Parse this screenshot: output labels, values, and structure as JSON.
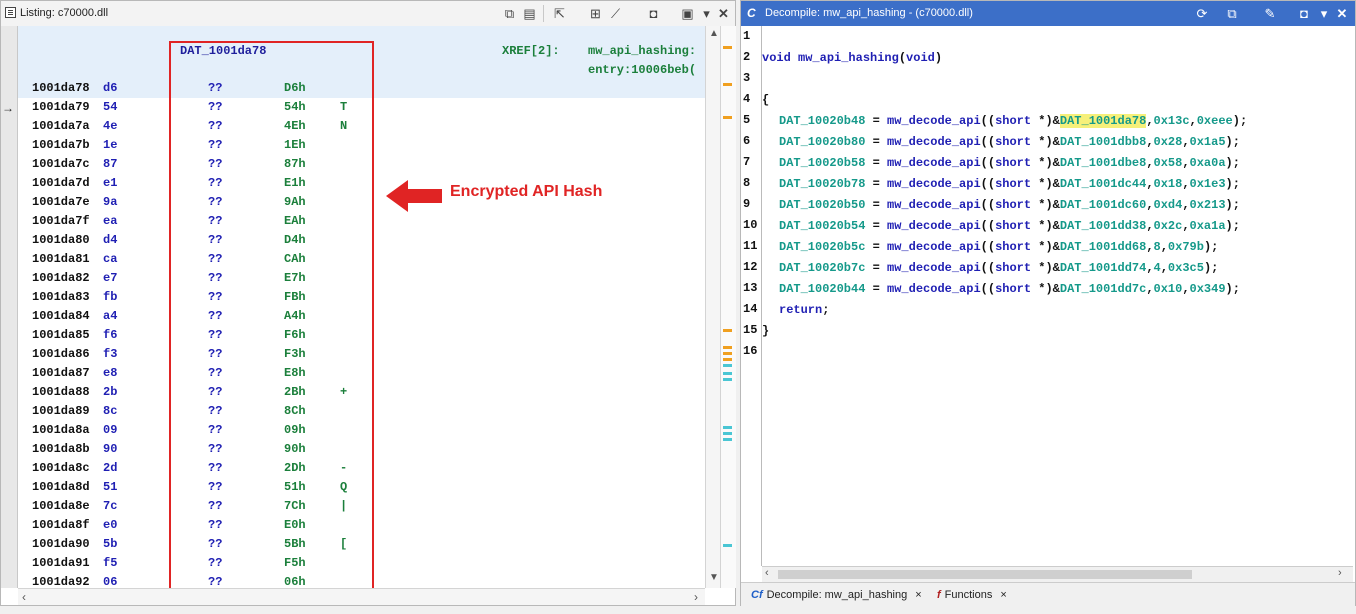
{
  "listing": {
    "title": "Listing:  c70000.dll",
    "label": "DAT_1001da78",
    "xref_label": "XREF[2]:",
    "xref_refs": [
      "mw_api_hashing:",
      "entry:10006beb("
    ],
    "cursor": "→",
    "rows": [
      {
        "addr": "1001da78",
        "byte": "d6",
        "qq": "??",
        "hex": "D6h",
        "chr": ""
      },
      {
        "addr": "1001da79",
        "byte": "54",
        "qq": "??",
        "hex": "54h",
        "chr": "T"
      },
      {
        "addr": "1001da7a",
        "byte": "4e",
        "qq": "??",
        "hex": "4Eh",
        "chr": "N"
      },
      {
        "addr": "1001da7b",
        "byte": "1e",
        "qq": "??",
        "hex": "1Eh",
        "chr": ""
      },
      {
        "addr": "1001da7c",
        "byte": "87",
        "qq": "??",
        "hex": "87h",
        "chr": ""
      },
      {
        "addr": "1001da7d",
        "byte": "e1",
        "qq": "??",
        "hex": "E1h",
        "chr": ""
      },
      {
        "addr": "1001da7e",
        "byte": "9a",
        "qq": "??",
        "hex": "9Ah",
        "chr": ""
      },
      {
        "addr": "1001da7f",
        "byte": "ea",
        "qq": "??",
        "hex": "EAh",
        "chr": ""
      },
      {
        "addr": "1001da80",
        "byte": "d4",
        "qq": "??",
        "hex": "D4h",
        "chr": ""
      },
      {
        "addr": "1001da81",
        "byte": "ca",
        "qq": "??",
        "hex": "CAh",
        "chr": ""
      },
      {
        "addr": "1001da82",
        "byte": "e7",
        "qq": "??",
        "hex": "E7h",
        "chr": ""
      },
      {
        "addr": "1001da83",
        "byte": "fb",
        "qq": "??",
        "hex": "FBh",
        "chr": ""
      },
      {
        "addr": "1001da84",
        "byte": "a4",
        "qq": "??",
        "hex": "A4h",
        "chr": ""
      },
      {
        "addr": "1001da85",
        "byte": "f6",
        "qq": "??",
        "hex": "F6h",
        "chr": ""
      },
      {
        "addr": "1001da86",
        "byte": "f3",
        "qq": "??",
        "hex": "F3h",
        "chr": ""
      },
      {
        "addr": "1001da87",
        "byte": "e8",
        "qq": "??",
        "hex": "E8h",
        "chr": ""
      },
      {
        "addr": "1001da88",
        "byte": "2b",
        "qq": "??",
        "hex": "2Bh",
        "chr": "+"
      },
      {
        "addr": "1001da89",
        "byte": "8c",
        "qq": "??",
        "hex": "8Ch",
        "chr": ""
      },
      {
        "addr": "1001da8a",
        "byte": "09",
        "qq": "??",
        "hex": "09h",
        "chr": ""
      },
      {
        "addr": "1001da8b",
        "byte": "90",
        "qq": "??",
        "hex": "90h",
        "chr": ""
      },
      {
        "addr": "1001da8c",
        "byte": "2d",
        "qq": "??",
        "hex": "2Dh",
        "chr": "-"
      },
      {
        "addr": "1001da8d",
        "byte": "51",
        "qq": "??",
        "hex": "51h",
        "chr": "Q"
      },
      {
        "addr": "1001da8e",
        "byte": "7c",
        "qq": "??",
        "hex": "7Ch",
        "chr": "|"
      },
      {
        "addr": "1001da8f",
        "byte": "e0",
        "qq": "??",
        "hex": "E0h",
        "chr": ""
      },
      {
        "addr": "1001da90",
        "byte": "5b",
        "qq": "??",
        "hex": "5Bh",
        "chr": "["
      },
      {
        "addr": "1001da91",
        "byte": "f5",
        "qq": "??",
        "hex": "F5h",
        "chr": ""
      },
      {
        "addr": "1001da92",
        "byte": "06",
        "qq": "??",
        "hex": "06h",
        "chr": ""
      }
    ]
  },
  "annotation": {
    "text": "Encrypted API Hash",
    "color": "#e02424"
  },
  "decompile": {
    "title": "Decompile: mw_api_hashing -  (c70000.dll)",
    "signature": {
      "type": "void",
      "name": "mw_api_hashing",
      "params": "void"
    },
    "open_brace": "{",
    "close_brace": "}",
    "return_kw": "return",
    "calls": [
      {
        "dst": "DAT_10020b48",
        "fn": "mw_decode_api",
        "cast": "short",
        "src": "DAT_1001da78",
        "a": "0x13c",
        "b": "0xeee",
        "highlight": true
      },
      {
        "dst": "DAT_10020b80",
        "fn": "mw_decode_api",
        "cast": "short",
        "src": "DAT_1001dbb8",
        "a": "0x28",
        "b": "0x1a5",
        "highlight": false
      },
      {
        "dst": "DAT_10020b58",
        "fn": "mw_decode_api",
        "cast": "short",
        "src": "DAT_1001dbe8",
        "a": "0x58",
        "b": "0xa0a",
        "highlight": false
      },
      {
        "dst": "DAT_10020b78",
        "fn": "mw_decode_api",
        "cast": "short",
        "src": "DAT_1001dc44",
        "a": "0x18",
        "b": "0x1e3",
        "highlight": false
      },
      {
        "dst": "DAT_10020b50",
        "fn": "mw_decode_api",
        "cast": "short",
        "src": "DAT_1001dc60",
        "a": "0xd4",
        "b": "0x213",
        "highlight": false
      },
      {
        "dst": "DAT_10020b54",
        "fn": "mw_decode_api",
        "cast": "short",
        "src": "DAT_1001dd38",
        "a": "0x2c",
        "b": "0xa1a",
        "highlight": false
      },
      {
        "dst": "DAT_10020b5c",
        "fn": "mw_decode_api",
        "cast": "short",
        "src": "DAT_1001dd68",
        "a": "8",
        "b": "0x79b",
        "highlight": false
      },
      {
        "dst": "DAT_10020b7c",
        "fn": "mw_decode_api",
        "cast": "short",
        "src": "DAT_1001dd74",
        "a": "4",
        "b": "0x3c5",
        "highlight": false
      },
      {
        "dst": "DAT_10020b44",
        "fn": "mw_decode_api",
        "cast": "short",
        "src": "DAT_1001dd7c",
        "a": "0x10",
        "b": "0x349",
        "highlight": false
      }
    ],
    "line_numbers": [
      "1",
      "2",
      "3",
      "4",
      "5",
      "6",
      "7",
      "8",
      "9",
      "10",
      "11",
      "12",
      "13",
      "14",
      "15",
      "16"
    ],
    "tabs": [
      {
        "icon": "Cf",
        "label": "Decompile: mw_api_hashing",
        "close": "×"
      },
      {
        "icon": "f",
        "label": "Functions",
        "close": "×"
      }
    ]
  }
}
